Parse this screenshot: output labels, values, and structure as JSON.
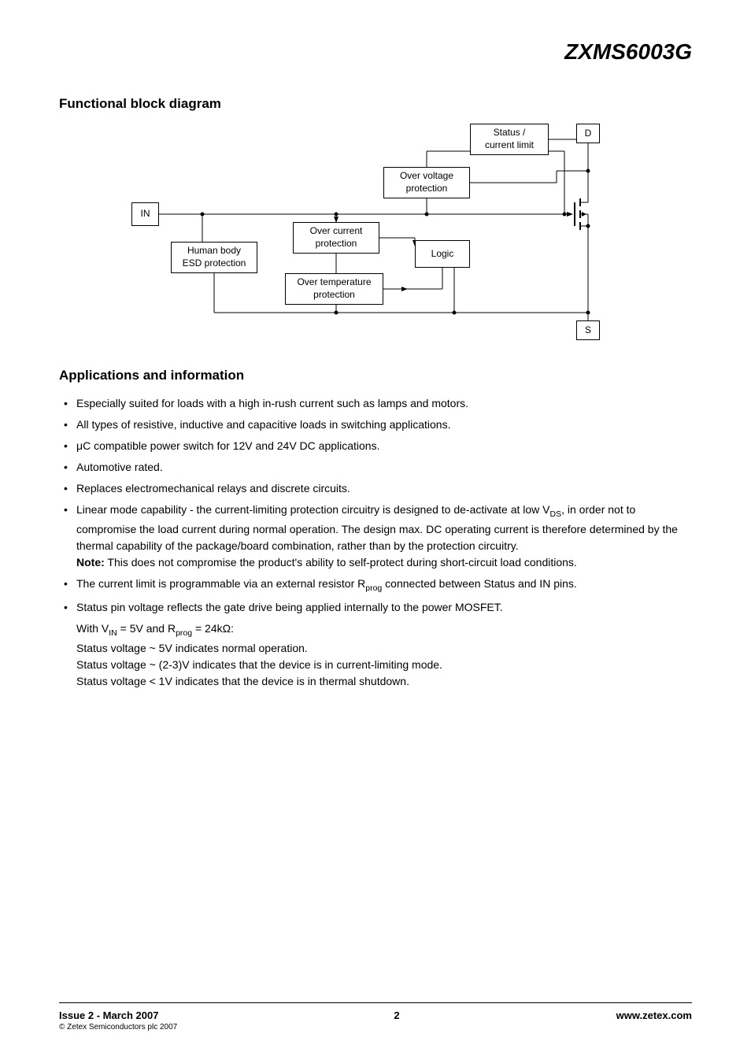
{
  "part_number": "ZXMS6003G",
  "sections": {
    "block_diagram_title": "Functional block diagram",
    "applications_title": "Applications and information"
  },
  "diagram": {
    "in": "IN",
    "esd_line1": "Human body",
    "esd_line2": "ESD protection",
    "ocp_line1": "Over current",
    "ocp_line2": "protection",
    "otp_line1": "Over temperature",
    "otp_line2": "protection",
    "ovp_line1": "Over voltage",
    "ovp_line2": "protection",
    "logic": "Logic",
    "status_line1": "Status /",
    "status_line2": "current limit",
    "d": "D",
    "s": "S"
  },
  "bullets": {
    "b1": "Especially suited for loads with a high in-rush current such as lamps and motors.",
    "b2": "All types of resistive, inductive and capacitive loads in switching applications.",
    "b3": "μC compatible power switch for 12V and 24V DC applications.",
    "b4": "Automotive rated.",
    "b5": "Replaces electromechanical relays and discrete circuits.",
    "b6_p1": "Linear mode capability - the current-limiting protection circuitry is designed to de-activate at low V",
    "b6_sub": "DS",
    "b6_p2": ", in order not to compromise the load current during normal operation. The design max. DC operating current is therefore determined by the thermal capability of the package/board combination, rather than by the protection circuitry.",
    "note_label": "Note:",
    "note_text": " This does not compromise the product's ability to self-protect during short-circuit load conditions.",
    "b7_p1": "The current limit is programmable via an external resistor R",
    "b7_sub": "prog",
    "b7_p2": " connected between Status and IN pins.",
    "b8_p1": "Status pin voltage reflects the gate drive being applied internally to the power MOSFET.",
    "b8_l2_p1": "With V",
    "b8_l2_sub1": "IN",
    "b8_l2_p2": " = 5V and R",
    "b8_l2_sub2": "prog",
    "b8_l2_p3": " = 24kΩ:",
    "b8_l3": "Status voltage ~ 5V indicates normal operation.",
    "b8_l4": "Status voltage ~ (2-3)V indicates that the device is in current-limiting mode.",
    "b8_l5": "Status voltage < 1V indicates that the device is in thermal shutdown."
  },
  "footer": {
    "issue": "Issue 2 - March 2007",
    "copyright": "© Zetex Semiconductors plc 2007",
    "page": "2",
    "url": "www.zetex.com"
  }
}
